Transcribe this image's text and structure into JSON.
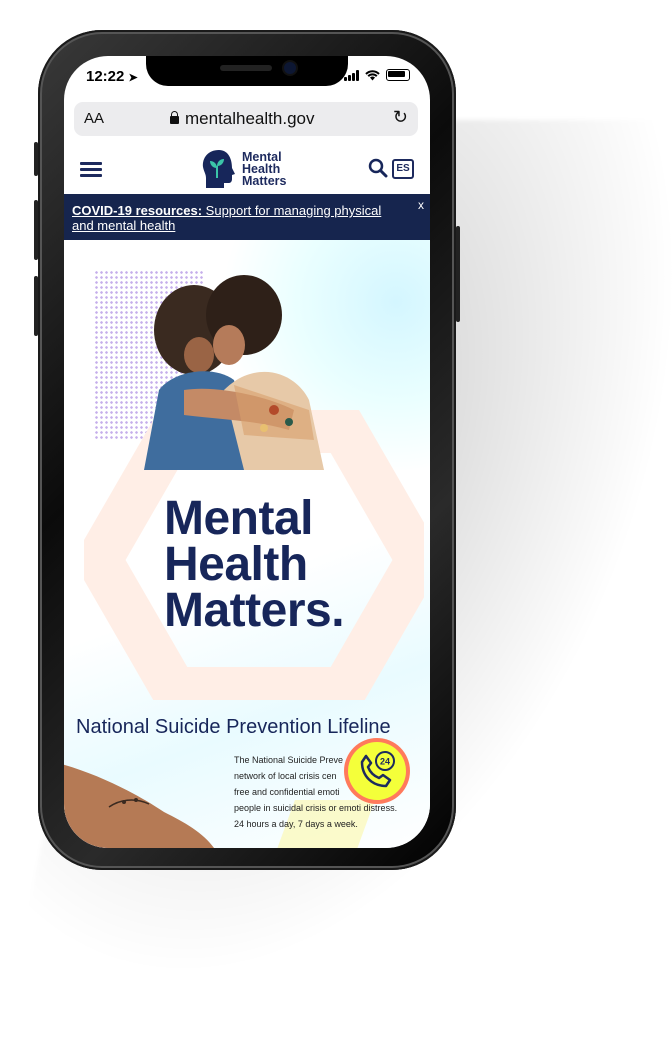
{
  "status_bar": {
    "time": "12:22"
  },
  "browser": {
    "text_size_label": "AA",
    "url": "mentalhealth.gov"
  },
  "site_header": {
    "logo_lines": [
      "Mental",
      "Health",
      "Matters"
    ],
    "language_toggle": "ES"
  },
  "alert": {
    "bold_text": "COVID-19 resources:",
    "link_text": " Support for managing physical and mental health",
    "close_label": "x"
  },
  "hero": {
    "headline_lines": [
      "Mental",
      "Health",
      "Matters."
    ]
  },
  "lifeline": {
    "title": "National Suicide Prevention Lifeline",
    "description_lines": [
      "The National Suicide Preve",
      "network of local crisis cen",
      "free and confidential emoti",
      "people in suicidal crisis or emoti distress.",
      "24 hours a day, 7 days a week."
    ],
    "call_badge": "24"
  },
  "colors": {
    "navy": "#17265a",
    "alert_bg": "#16254e",
    "call_button": "#f4ff3a",
    "call_ring": "#ff7a5c"
  }
}
